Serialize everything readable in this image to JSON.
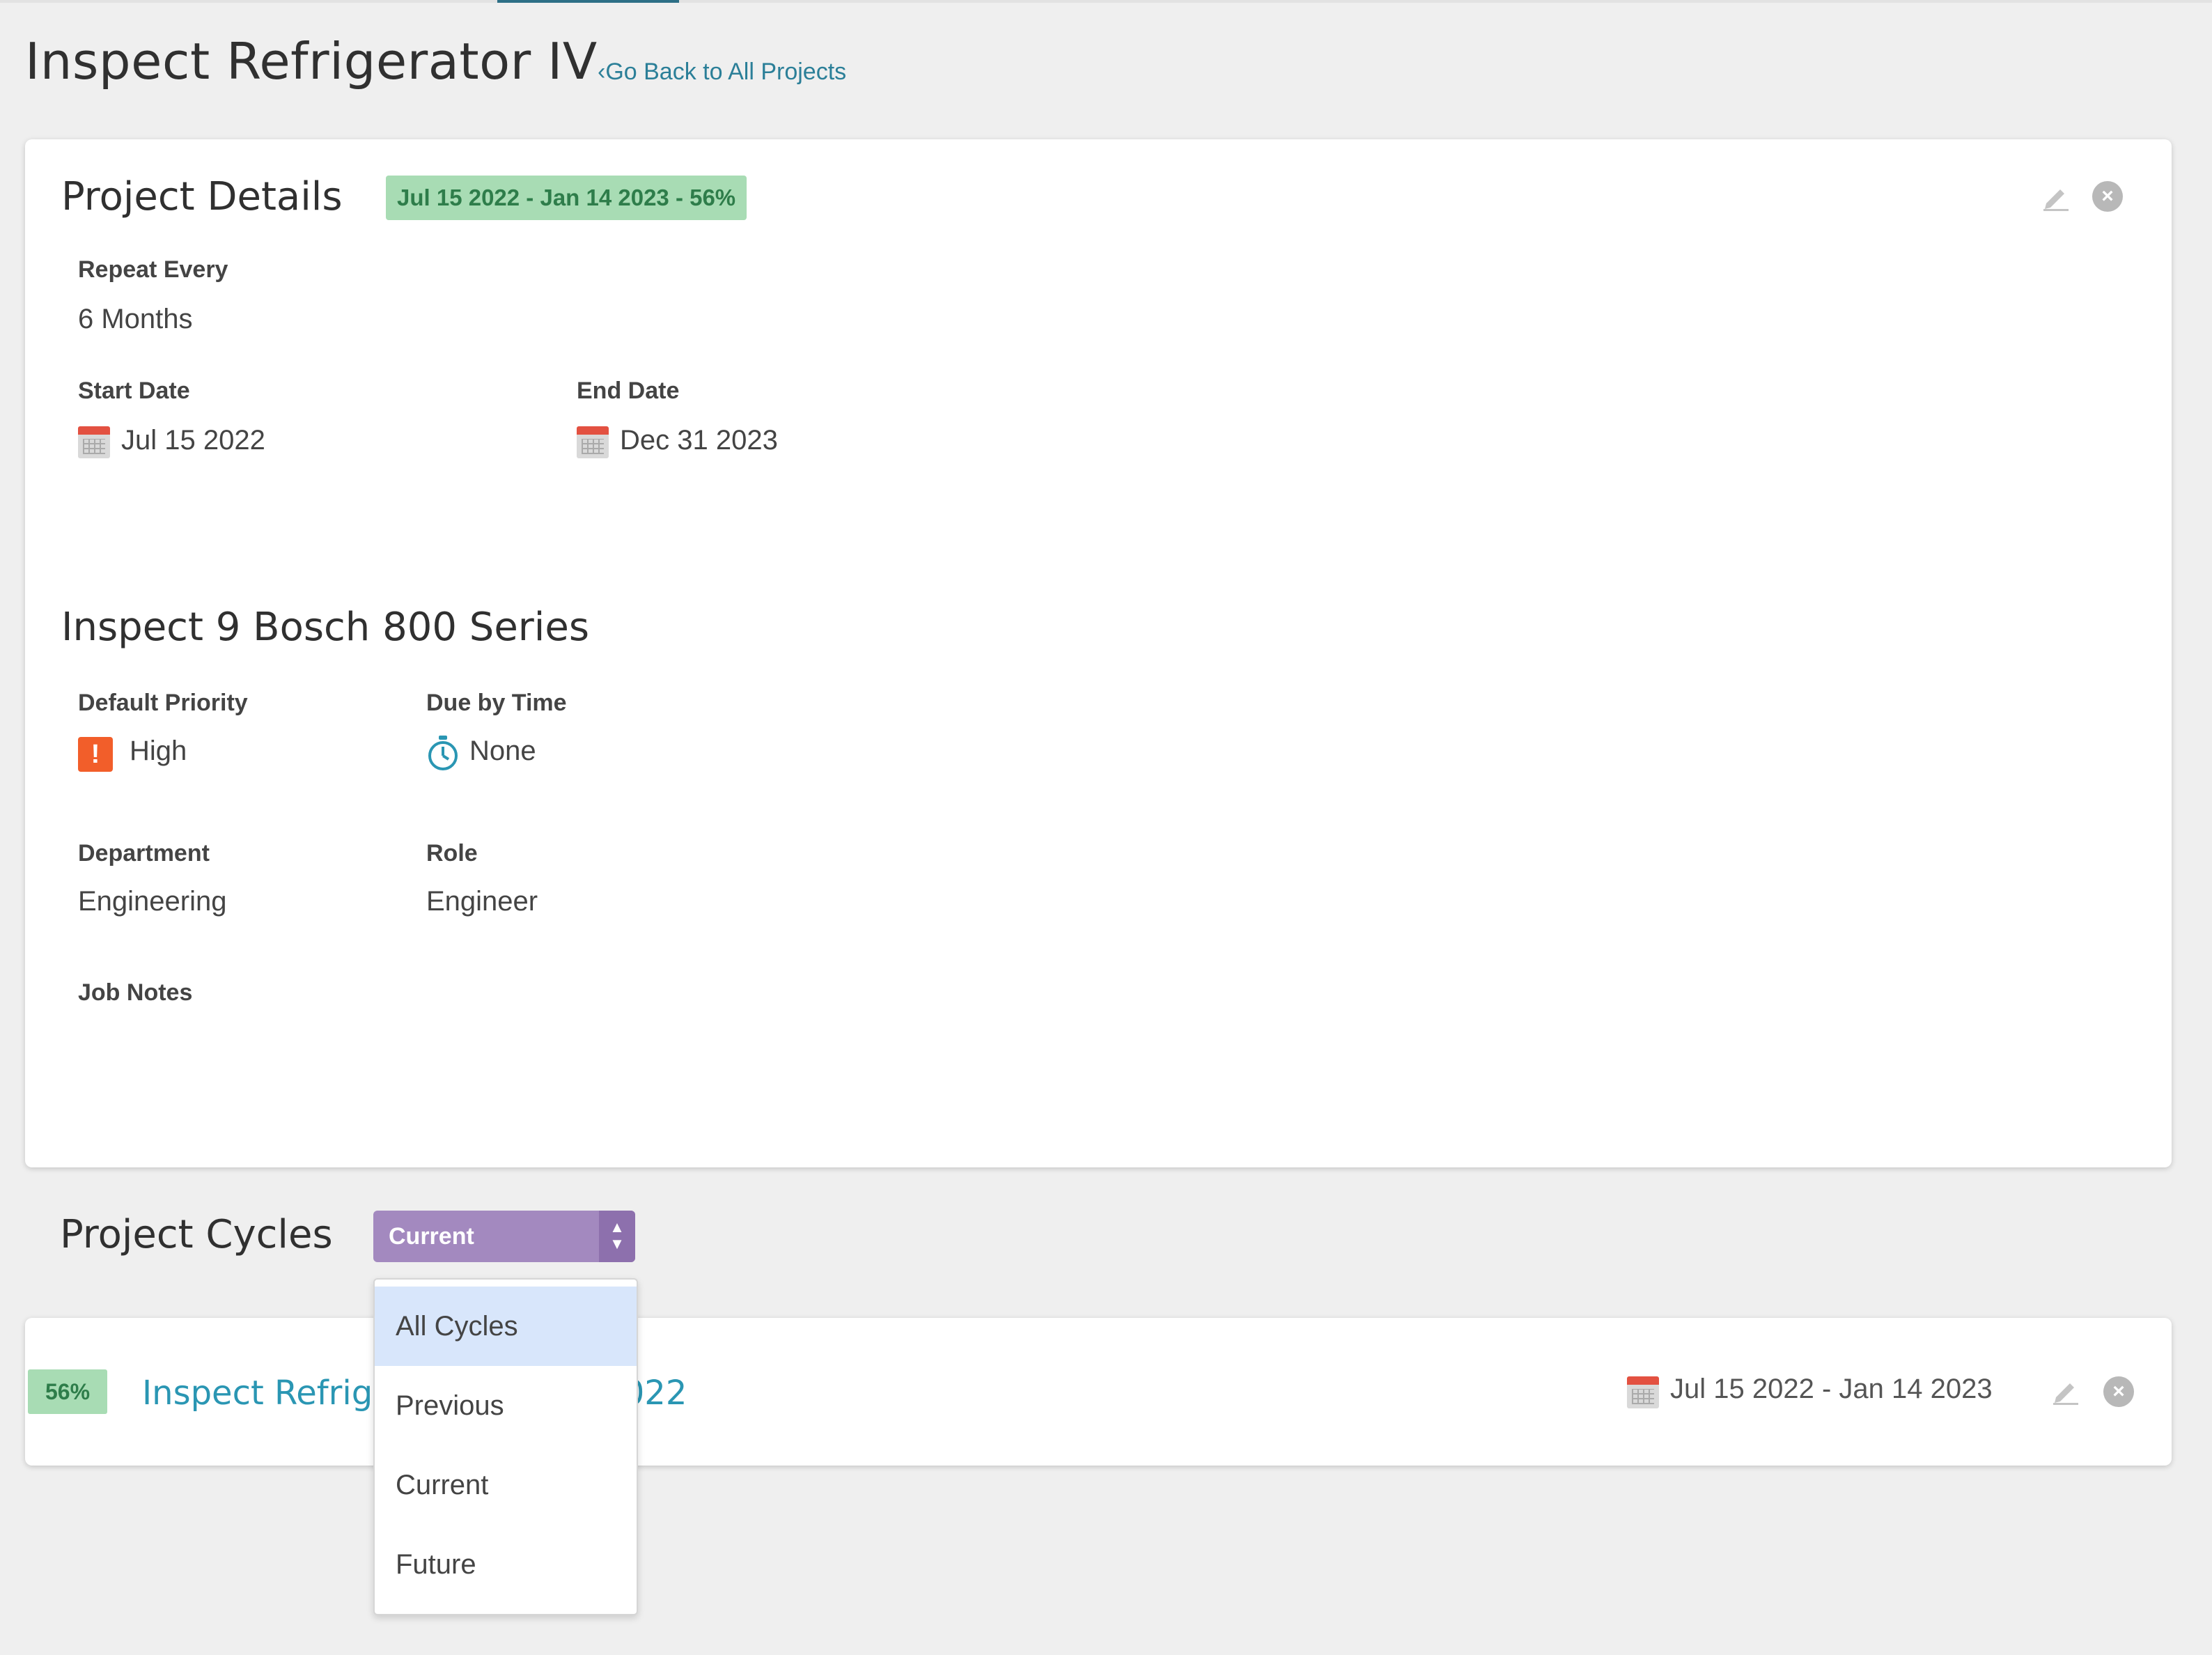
{
  "page": {
    "title": "Inspect Refrigerator IV",
    "back_link": "Go Back to All Projects"
  },
  "details": {
    "heading": "Project Details",
    "range_badge": "Jul 15 2022 - Jan 14 2023 - 56%",
    "repeat_label": "Repeat Every",
    "repeat_value": "6 Months",
    "start_label": "Start Date",
    "start_value": "Jul 15 2022",
    "end_label": "End Date",
    "end_value": "Dec 31 2023"
  },
  "task": {
    "heading": "Inspect 9 Bosch 800 Series",
    "priority_label": "Default Priority",
    "priority_value": "High",
    "due_label": "Due by Time",
    "due_value": "None",
    "department_label": "Department",
    "department_value": "Engineering",
    "role_label": "Role",
    "role_value": "Engineer",
    "notes_label": "Job Notes"
  },
  "cycles": {
    "heading": "Project Cycles",
    "selected": "Current",
    "options": [
      "All Cycles",
      "Previous",
      "Current",
      "Future"
    ],
    "highlighted_option": "All Cycles"
  },
  "cycle_row": {
    "percent": "56%",
    "name_visible_left": "Inspect Refrige",
    "name_visible_right": "022",
    "date_range": "Jul 15 2022 - Jan 14 2023"
  },
  "colors": {
    "accent_link": "#2a96b3",
    "badge_green_bg": "#a8dcb4",
    "select_purple": "#a389bf",
    "priority_orange": "#f25e2a"
  },
  "icons": {
    "edit": "pencil-icon",
    "delete": "close-circle-icon",
    "calendar": "calendar-icon",
    "priority": "exclamation-icon",
    "timer": "stopwatch-icon",
    "back": "chevron-left-icon",
    "select": "updown-arrows-icon"
  }
}
